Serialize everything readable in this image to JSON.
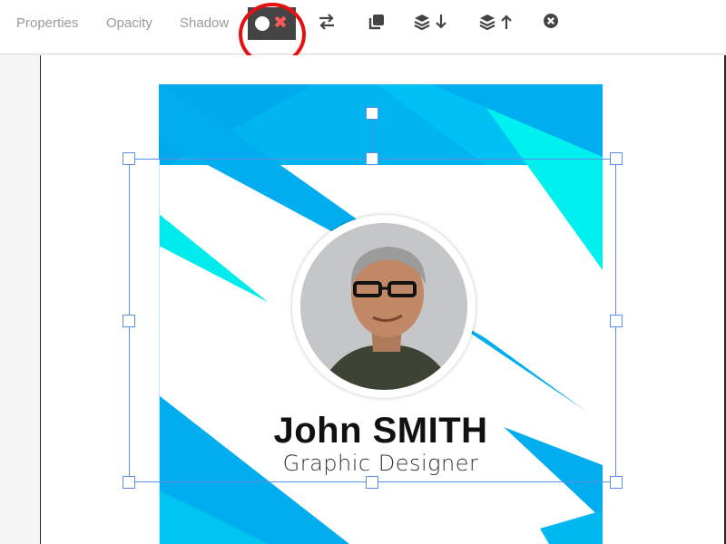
{
  "toolbar": {
    "properties_label": "Properties",
    "opacity_label": "Opacity",
    "shadow_label": "Shadow",
    "icons": {
      "toggle": "toggle-off-icon",
      "swap": "swap-arrows-icon",
      "duplicate": "copy-icon",
      "send_backward": "layers-down-icon",
      "bring_forward": "layers-up-icon",
      "delete": "close-circle-icon"
    }
  },
  "card": {
    "name": "John SMITH",
    "title": "Graphic Designer"
  },
  "colors": {
    "accent_blue": "#00aeef",
    "accent_cyan": "#00f0f0",
    "highlight": "#e51010",
    "selection": "#5b8ee6"
  }
}
